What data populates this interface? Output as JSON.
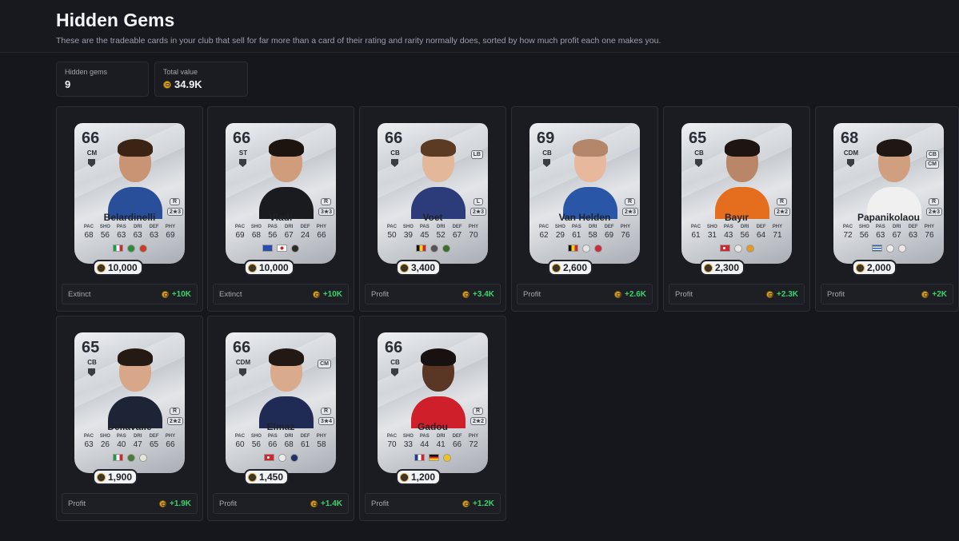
{
  "page": {
    "title": "Hidden Gems",
    "subtitle": "These are the tradeable cards in your club that sell for far more than a card of their rating and rarity normally does, sorted by how much profit each one makes you."
  },
  "stats": {
    "hidden_gems_label": "Hidden gems",
    "hidden_gems_value": "9",
    "total_value_label": "Total value",
    "total_value_value": "34.9K"
  },
  "cards": [
    {
      "rating": "66",
      "pos": "CM",
      "alt_pos": "",
      "alt_pos2": "",
      "foot": "R",
      "skills": "2★3",
      "name": "Belardinelli",
      "stats": [
        "68",
        "56",
        "63",
        "63",
        "63",
        "69"
      ],
      "flags": [
        "it",
        "club-green",
        "club-red"
      ],
      "price": "10,000",
      "footer_label": "Extinct",
      "profit": "+10K",
      "skin": "#c89473",
      "hair": "#3b2413",
      "shirt": "#2a4f9a"
    },
    {
      "rating": "66",
      "pos": "ST",
      "alt_pos": "",
      "alt_pos2": "",
      "foot": "R",
      "skills": "3★3",
      "name": "Vladi",
      "stats": [
        "69",
        "68",
        "56",
        "67",
        "24",
        "66"
      ],
      "flags": [
        "xk",
        "jp",
        "club-black"
      ],
      "price": "10,000",
      "footer_label": "Extinct",
      "profit": "+10K",
      "skin": "#cf9c7c",
      "hair": "#1d1410",
      "shirt": "#1a1b1e"
    },
    {
      "rating": "66",
      "pos": "CB",
      "alt_pos": "LB",
      "alt_pos2": "",
      "foot": "L",
      "skills": "2★3",
      "name": "Voet",
      "stats": [
        "50",
        "39",
        "45",
        "52",
        "67",
        "70"
      ],
      "flags": [
        "be",
        "club-bw",
        "club-green2"
      ],
      "price": "3,400",
      "footer_label": "Profit",
      "profit": "+3.4K",
      "skin": "#e2b79a",
      "hair": "#5b3b24",
      "shirt": "#2c3c7a"
    },
    {
      "rating": "69",
      "pos": "CB",
      "alt_pos": "",
      "alt_pos2": "",
      "foot": "R",
      "skills": "2★3",
      "name": "Van Helden",
      "stats": [
        "62",
        "29",
        "61",
        "58",
        "69",
        "76"
      ],
      "flags": [
        "nl-be",
        "club-white",
        "club-red2"
      ],
      "price": "2,600",
      "footer_label": "Profit",
      "profit": "+2.6K",
      "skin": "#e8b89d",
      "hair": "#b4876a",
      "shirt": "#2a56a8"
    },
    {
      "rating": "65",
      "pos": "CB",
      "alt_pos": "",
      "alt_pos2": "",
      "foot": "R",
      "skills": "2★2",
      "name": "Bayır",
      "stats": [
        "61",
        "31",
        "43",
        "56",
        "64",
        "71"
      ],
      "flags": [
        "tr",
        "club-white2",
        "club-orange"
      ],
      "price": "2,300",
      "footer_label": "Profit",
      "profit": "+2.3K",
      "skin": "#b98767",
      "hair": "#1c1512",
      "shirt": "#e46e1e"
    },
    {
      "rating": "68",
      "pos": "CDM",
      "alt_pos": "CB",
      "alt_pos2": "CM",
      "foot": "R",
      "skills": "2★3",
      "name": "Papanikolaou",
      "stats": [
        "72",
        "56",
        "63",
        "67",
        "63",
        "76"
      ],
      "flags": [
        "gr",
        "club-white3",
        "club-white4"
      ],
      "price": "2,000",
      "footer_label": "Profit",
      "profit": "+2K",
      "skin": "#cf9f80",
      "hair": "#1e1714",
      "shirt": "#f0f0f0"
    },
    {
      "rating": "65",
      "pos": "CB",
      "alt_pos": "",
      "alt_pos2": "",
      "foot": "R",
      "skills": "2★2",
      "name": "Dellavalle",
      "stats": [
        "63",
        "26",
        "40",
        "47",
        "65",
        "66"
      ],
      "flags": [
        "it",
        "club-green3",
        "club-white5"
      ],
      "price": "1,900",
      "footer_label": "Profit",
      "profit": "+1.9K",
      "skin": "#d8a688",
      "hair": "#251913",
      "shirt": "#1d2436"
    },
    {
      "rating": "66",
      "pos": "CDM",
      "alt_pos": "CM",
      "alt_pos2": "",
      "foot": "R",
      "skills": "3★4",
      "name": "Elmaz",
      "stats": [
        "60",
        "56",
        "66",
        "68",
        "61",
        "58"
      ],
      "flags": [
        "tr",
        "club-white6",
        "club-navy"
      ],
      "price": "1,450",
      "footer_label": "Profit",
      "profit": "+1.4K",
      "skin": "#d9aa8b",
      "hair": "#221915",
      "shirt": "#1f2a55"
    },
    {
      "rating": "66",
      "pos": "CB",
      "alt_pos": "",
      "alt_pos2": "",
      "foot": "R",
      "skills": "2★2",
      "name": "Gadou",
      "stats": [
        "70",
        "33",
        "44",
        "41",
        "66",
        "72"
      ],
      "flags": [
        "fr",
        "de",
        "club-yellow"
      ],
      "price": "1,200",
      "footer_label": "Profit",
      "profit": "+1.2K",
      "skin": "#5a3624",
      "hair": "#171110",
      "shirt": "#cf1f2a"
    }
  ],
  "stat_headers": [
    "PAC",
    "SHO",
    "PAS",
    "DRI",
    "DEF",
    "PHY"
  ],
  "colors": {
    "background": "#15171c",
    "profit_green": "#3ad36a",
    "coin_gold": "#d9a21b"
  }
}
